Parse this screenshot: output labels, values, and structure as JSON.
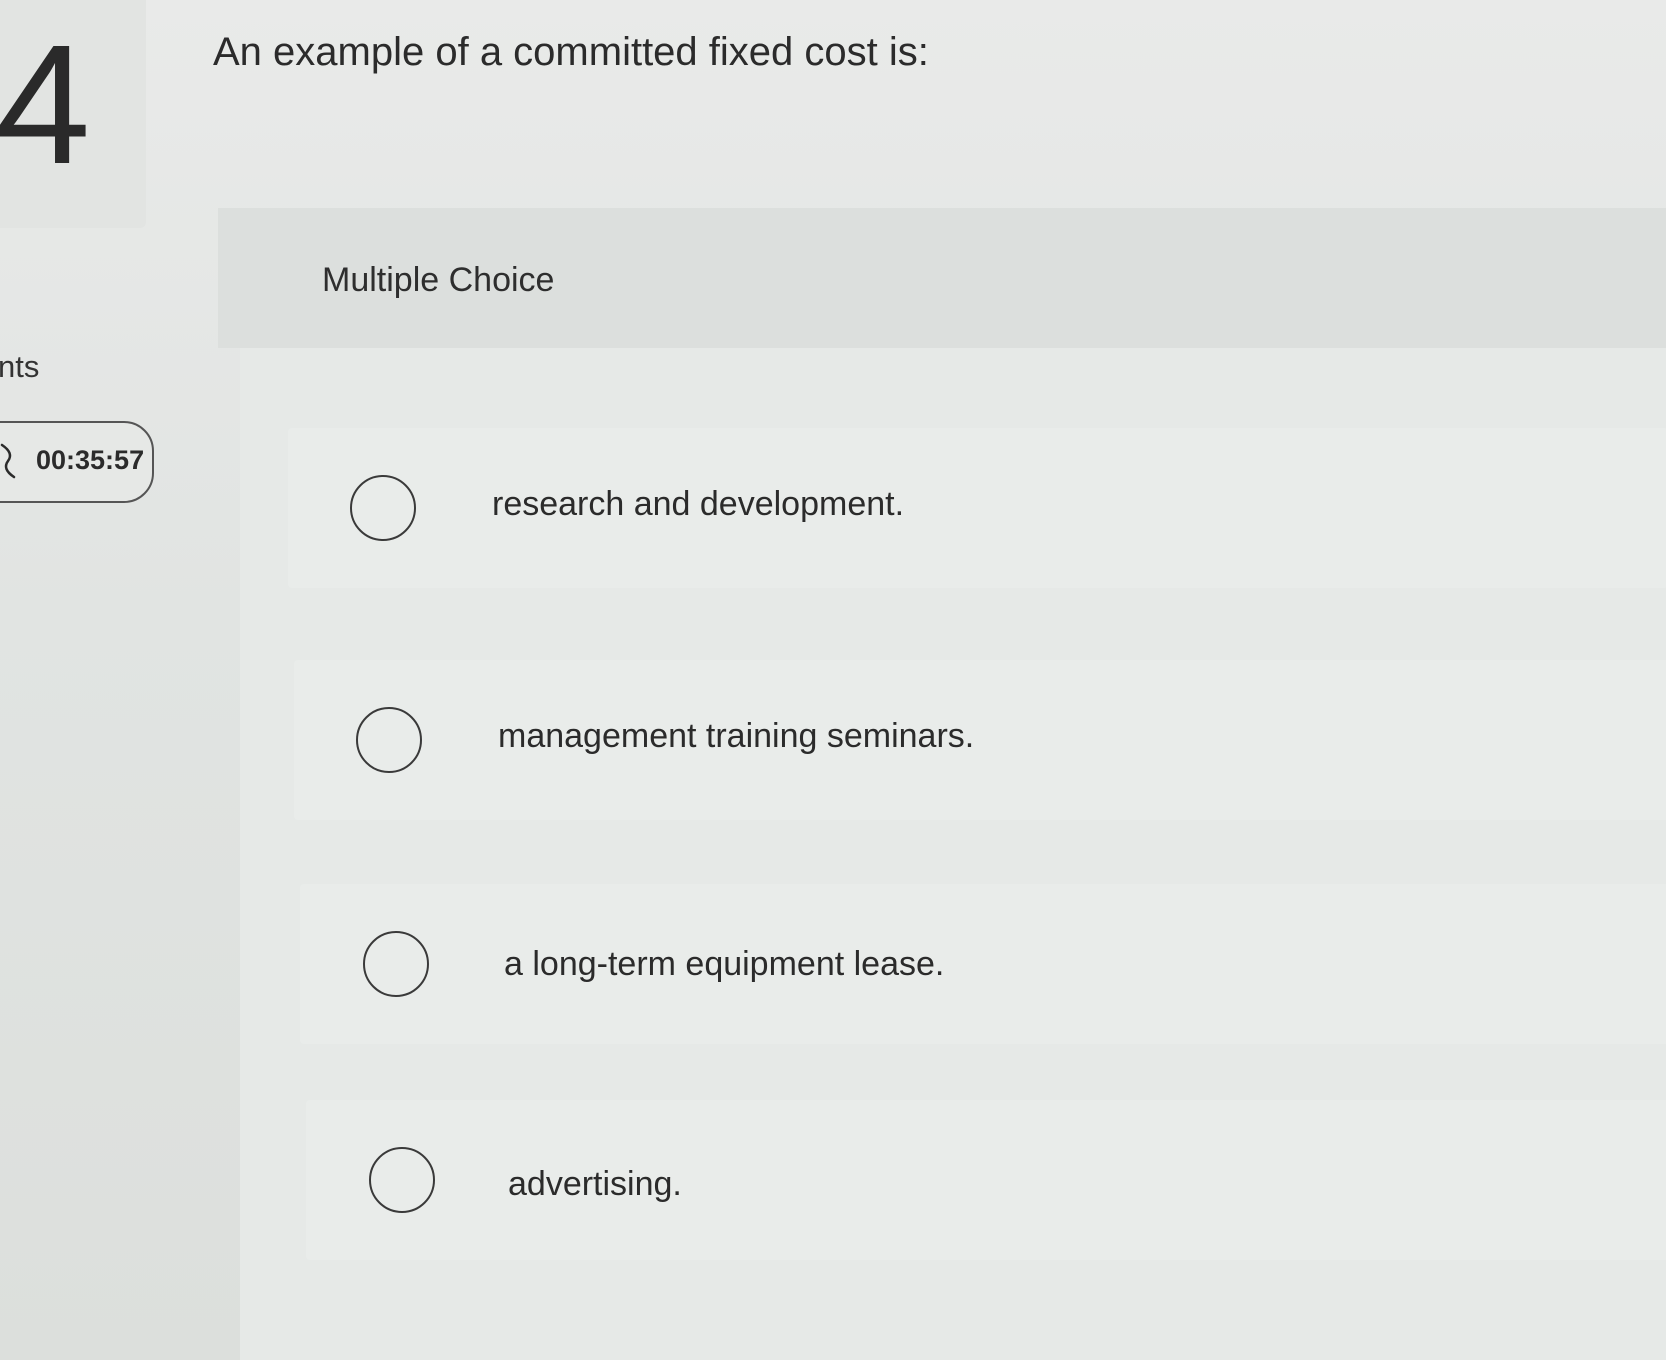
{
  "question": {
    "number": "4",
    "text": "An example of a committed fixed cost is:",
    "points_label": "nts",
    "type_label": "Multiple Choice"
  },
  "timer": {
    "value": "00:35:57",
    "icon": "hourglass-icon"
  },
  "options": [
    {
      "text": "research and development.",
      "selected": false
    },
    {
      "text": "management training seminars.",
      "selected": false
    },
    {
      "text": "a long-term equipment lease.",
      "selected": false
    },
    {
      "text": "advertising.",
      "selected": false
    }
  ]
}
